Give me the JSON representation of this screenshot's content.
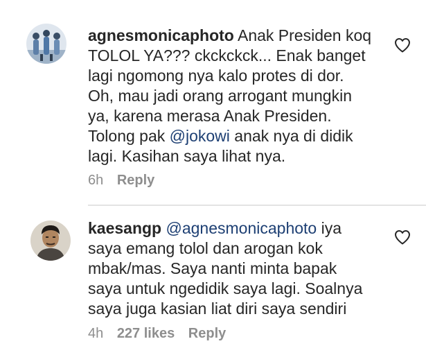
{
  "comments": [
    {
      "username": "agnesmonicaphoto",
      "lines": [
        {
          "text": "Anak Presiden koq"
        },
        {
          "text": "TOLOL YA??? ckckckck... Enak banget"
        },
        {
          "text": "lagi ngomong nya kalo protes di dor."
        },
        {
          "text": "Oh, mau jadi orang arrogant mungkin"
        },
        {
          "text": "ya, karena merasa Anak Presiden."
        },
        {
          "before": "Tolong pak ",
          "mention": "@jokowi",
          "after": " anak nya di didik"
        },
        {
          "text": "lagi. Kasihan saya lihat nya."
        }
      ],
      "time": "6h",
      "likes": "",
      "reply_label": "Reply",
      "avatar_icon": "avatar-group-photo-icon",
      "like_icon": "heart-outline-icon"
    },
    {
      "username": "kaesangp",
      "lines": [
        {
          "mention": "@agnesmonicaphoto",
          "after": " iya"
        },
        {
          "text": "saya emang tolol dan arogan kok"
        },
        {
          "text": "mbak/mas. Saya nanti minta bapak"
        },
        {
          "text": "saya untuk ngedidik saya lagi. Soalnya"
        },
        {
          "text": "saya juga kasian liat diri saya sendiri"
        }
      ],
      "time": "4h",
      "likes": "227 likes",
      "reply_label": "Reply",
      "avatar_icon": "avatar-profile-face-icon",
      "like_icon": "heart-outline-icon"
    }
  ],
  "colors": {
    "text": "#262626",
    "meta": "#8e8e8e",
    "mention": "#1d3f73",
    "divider": "#e3e3e3"
  }
}
